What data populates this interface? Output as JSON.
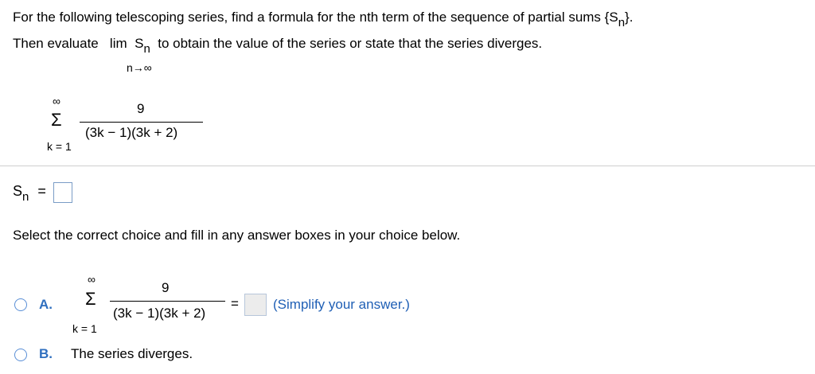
{
  "question": {
    "line1_a": "For the following telescoping series, find a formula for the nth term of the sequence of partial sums {S",
    "line1_sub": "n",
    "line1_b": "}.",
    "line2_a": "Then evaluate",
    "lim_word": "lim",
    "lim_var": "S",
    "lim_sub": "n",
    "line2_b": "to obtain the value of the series or state that the series diverges.",
    "lim_under": "n→∞"
  },
  "series": {
    "upper": "∞",
    "sigma": "Σ",
    "lower": "k = 1",
    "numerator": "9",
    "denominator": "(3k − 1)(3k + 2)"
  },
  "sn_answer": {
    "var": "S",
    "sub": "n",
    "equals": "="
  },
  "instruction": "Select the correct choice and fill in any answer boxes in your choice below.",
  "choice_a": {
    "letter": "A.",
    "upper": "∞",
    "sigma": "Σ",
    "lower": "k = 1",
    "numerator": "9",
    "denominator": "(3k − 1)(3k + 2)",
    "equals": "=",
    "hint": "(Simplify your answer.)"
  },
  "choice_b": {
    "letter": "B.",
    "text": "The series diverges."
  }
}
